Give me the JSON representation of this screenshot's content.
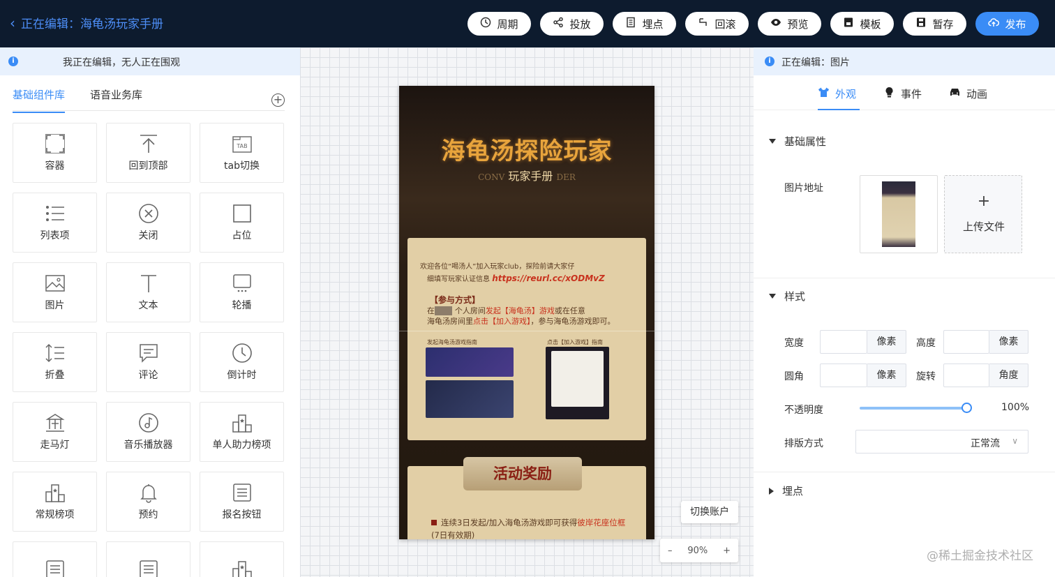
{
  "header": {
    "back_label": "正在编辑：海龟汤玩家手册",
    "buttons": [
      {
        "label": "周期",
        "icon": "clock-icon"
      },
      {
        "label": "投放",
        "icon": "share-icon"
      },
      {
        "label": "埋点",
        "icon": "document-icon"
      },
      {
        "label": "回滚",
        "icon": "return-icon"
      },
      {
        "label": "预览",
        "icon": "eye-icon"
      },
      {
        "label": "模板",
        "icon": "template-icon"
      },
      {
        "label": "暂存",
        "icon": "save-icon"
      },
      {
        "label": "发布",
        "icon": "cloud-upload-icon"
      }
    ]
  },
  "left_panel": {
    "info": "我正在编辑，无人正在围观",
    "tabs": [
      "基础组件库",
      "语音业务库"
    ],
    "components": [
      {
        "label": "容器",
        "icon": "container-icon"
      },
      {
        "label": "回到顶部",
        "icon": "back-to-top-icon"
      },
      {
        "label": "tab切换",
        "icon": "tab-icon"
      },
      {
        "label": "列表项",
        "icon": "list-icon"
      },
      {
        "label": "关闭",
        "icon": "close-circle-icon"
      },
      {
        "label": "占位",
        "icon": "placeholder-icon"
      },
      {
        "label": "图片",
        "icon": "image-icon"
      },
      {
        "label": "文本",
        "icon": "text-icon"
      },
      {
        "label": "轮播",
        "icon": "carousel-icon"
      },
      {
        "label": "折叠",
        "icon": "collapse-icon"
      },
      {
        "label": "评论",
        "icon": "comment-icon"
      },
      {
        "label": "倒计时",
        "icon": "countdown-icon"
      },
      {
        "label": "走马灯",
        "icon": "carousel-horse-icon"
      },
      {
        "label": "音乐播放器",
        "icon": "music-icon"
      },
      {
        "label": "单人助力榜项",
        "icon": "ranking-icon"
      },
      {
        "label": "常规榜项",
        "icon": "ranking-icon"
      },
      {
        "label": "预约",
        "icon": "bell-icon"
      },
      {
        "label": "报名按钮",
        "icon": "form-icon"
      },
      {
        "label": "",
        "icon": "form-icon"
      },
      {
        "label": "",
        "icon": "form-icon"
      },
      {
        "label": "",
        "icon": "ranking-icon"
      }
    ]
  },
  "canvas": {
    "poster": {
      "title": "海龟汤探险玩家",
      "subtitle": "玩家手册",
      "subtitle_left": "CONV",
      "subtitle_right": "DER",
      "intro_line1": "欢迎各位“喝汤人”加入玩家club，探险前请大家仔",
      "intro_line2": "细填写玩家认证信息",
      "link": "https://reurl.cc/xODMvZ",
      "join_heading": "【参与方式】",
      "join_prefix": "在",
      "join_mid": "个人房间",
      "join_red1": "发起【海龟汤】游戏",
      "join_mid2": "或在任意",
      "join_line2_prefix": "海龟汤房间里",
      "join_red2": "点击【加入游戏】",
      "join_line2_suffix": "，参与海龟汤游戏即可。",
      "guide_left": "发起海龟汤游戏指南",
      "guide_right": "点击【加入游戏】指南",
      "reward_title": "活动奖励",
      "reward_text": "连续3日发起/加入海龟汤游戏即可获得",
      "reward_red": "彼岸花座位框",
      "reward_note": "(7日有效期)"
    },
    "switch_account": "切换账户",
    "zoom": {
      "minus": "–",
      "value": "90%",
      "plus": "+"
    }
  },
  "right_panel": {
    "info": "正在编辑：图片",
    "tabs": [
      {
        "label": "外观",
        "icon": "shirt-icon"
      },
      {
        "label": "事件",
        "icon": "bulb-icon"
      },
      {
        "label": "动画",
        "icon": "car-icon"
      }
    ],
    "basic_section": "基础属性",
    "image_url_label": "图片地址",
    "upload_plus": "+",
    "upload_label": "上传文件",
    "style_section": "样式",
    "width_label": "宽度",
    "height_label": "高度",
    "radius_label": "圆角",
    "rotate_label": "旋转",
    "unit_px": "像素",
    "unit_deg": "角度",
    "opacity_label": "不透明度",
    "opacity_value": "100%",
    "layout_label": "排版方式",
    "layout_value": "正常流",
    "tracking_section": "埋点"
  },
  "watermark": "@稀土掘金技术社区",
  "colors": {
    "topbar": "#0d1b2e",
    "accent": "#3a8cf6",
    "info_bg": "#e8f1fd"
  }
}
